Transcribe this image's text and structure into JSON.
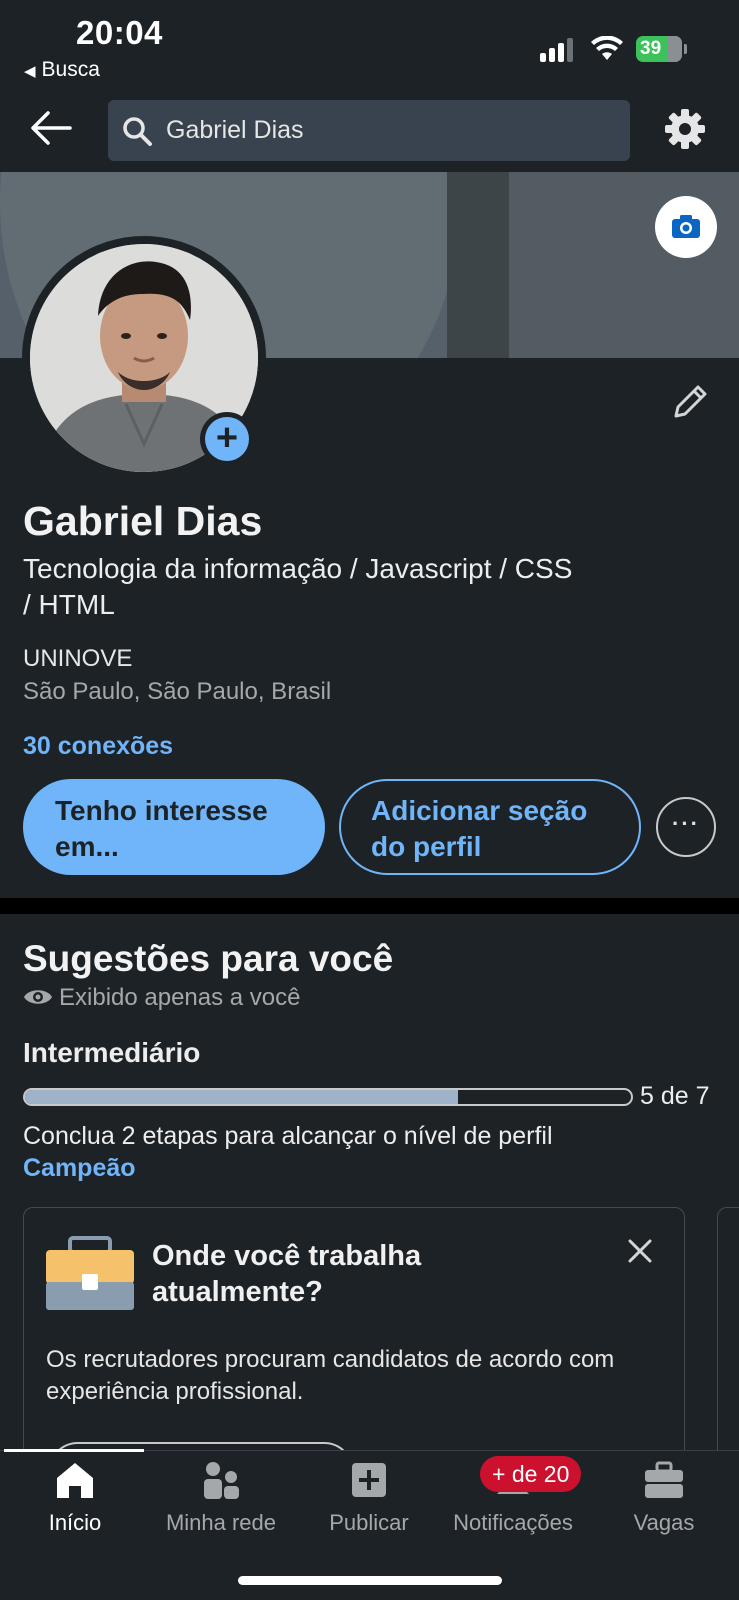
{
  "status_bar": {
    "time": "20:04",
    "back_app": "Busca",
    "battery": "39"
  },
  "header": {
    "search_value": "Gabriel Dias"
  },
  "profile": {
    "name": "Gabriel Dias",
    "headline": "Tecnologia da informação / Javascript / CSS / HTML",
    "school": "UNINOVE",
    "location": "São Paulo, São Paulo, Brasil",
    "connections": "30 conexões",
    "primary_button": "Tenho interesse em...",
    "secondary_button": "Adicionar seção do perfil",
    "more_button": "···"
  },
  "suggestions": {
    "title": "Sugestões para você",
    "visibility": "Exibido apenas a você",
    "level": "Intermediário",
    "progress_value": 5,
    "progress_total": 7,
    "progress_label": "5 de 7",
    "steps_text": "Conclua 2 etapas para alcançar o nível de perfil",
    "steps_link": "Campeão",
    "card": {
      "title": "Onde você trabalha atualmente?",
      "text": "Os recrutadores procuram candidatos de acordo com experiência profissional."
    }
  },
  "nav": {
    "items": [
      {
        "label": "Início",
        "icon": "home-icon"
      },
      {
        "label": "Minha rede",
        "icon": "network-icon"
      },
      {
        "label": "Publicar",
        "icon": "post-icon"
      },
      {
        "label": "Notificações",
        "icon": "bell-icon"
      },
      {
        "label": "Vagas",
        "icon": "briefcase-icon"
      }
    ],
    "notifications_badge": "+ de 20"
  },
  "colors": {
    "accent": "#70b5f9",
    "background": "#1d2226",
    "badge": "#cb112d"
  }
}
